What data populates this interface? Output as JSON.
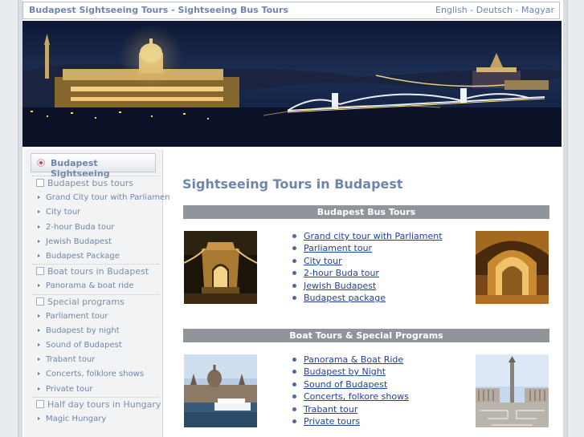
{
  "header": {
    "site_title": "Budapest Sightseeing Tours - Sightseeing Bus Tours",
    "lang_english": "English",
    "lang_deutsch": "Deutsch",
    "lang_magyar": "Magyar",
    "lang_sep": " - "
  },
  "sidebar": {
    "heading": "Budapest Sightseeing",
    "groups": [
      {
        "category": "Budapest bus tours",
        "items": [
          "Grand City tour with Parliament",
          "City tour",
          "2-hour Buda tour",
          "Jewish Budapest",
          "Budapest Package"
        ]
      },
      {
        "category": "Boat tours in Budapest",
        "items": [
          "Panorama & boat ride"
        ]
      },
      {
        "category": "Special programs",
        "items": [
          "Parliament tour",
          "Budapest by night",
          "Sound of Budapest",
          "Trabant tour",
          "Concerts, folklore shows",
          "Private tour"
        ]
      },
      {
        "category": "Half day tours in Hungary",
        "items": [
          "Magic Hungary"
        ]
      }
    ]
  },
  "main": {
    "title": "Sightseeing Tours in Budapest",
    "sections": [
      {
        "heading": "Budapest Bus Tours",
        "links": [
          "Grand city tour with Parliament",
          "Parliament tour",
          "City tour",
          "2-hour Buda tour",
          "Jewish Budapest",
          "Budapest package"
        ]
      },
      {
        "heading": "Boat Tours & Special Programs",
        "links": [
          "Panorama & Boat Ride",
          "Budapest by Night",
          "Sound of Budapest",
          "Concerts, folkore shows",
          "Trabant tour",
          "Private tours"
        ]
      }
    ]
  },
  "colors": {
    "accent": "#6f86a9",
    "link": "#21429c",
    "section_bar": "#8f959b"
  }
}
